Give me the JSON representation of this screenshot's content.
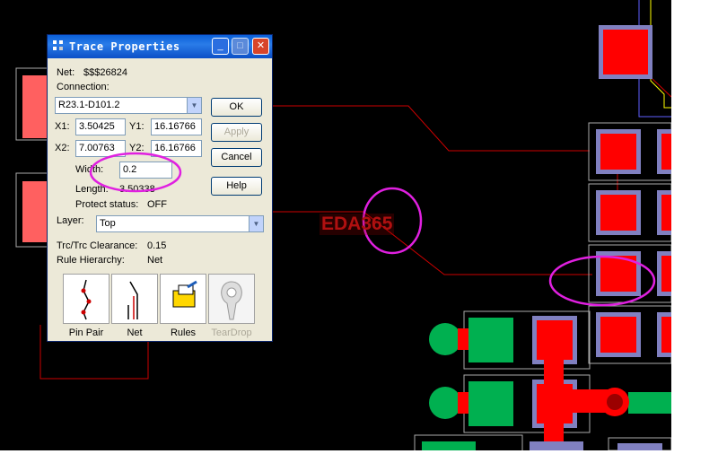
{
  "dialog": {
    "title": "Trace Properties",
    "net_label": "Net:",
    "net_value": "$$$26824",
    "connection_label": "Connection:",
    "connection_value": "R23.1-D101.2",
    "x1_label": "X1:",
    "x1_value": "3.50425",
    "y1_label": "Y1:",
    "y1_value": "16.16766",
    "x2_label": "X2:",
    "x2_value": "7.00763",
    "y2_label": "Y2:",
    "y2_value": "16.16766",
    "width_label": "Width:",
    "width_value": "0.2",
    "length_label": "Length:",
    "length_value": "3.50338",
    "protect_label": "Protect status:",
    "protect_value": "OFF",
    "layer_label": "Layer:",
    "layer_value": "Top",
    "clearance_label": "Trc/Trc Clearance:",
    "clearance_value": "0.15",
    "hierarchy_label": "Rule Hierarchy:",
    "hierarchy_value": "Net",
    "buttons": {
      "ok": "OK",
      "apply": "Apply",
      "cancel": "Cancel",
      "help": "Help"
    },
    "tools": {
      "pin_pair": "Pin Pair",
      "net": "Net",
      "rules": "Rules",
      "teardrop": "TearDrop"
    }
  },
  "watermark": "EDA365",
  "colors": {
    "pad": "#ff0000",
    "pad_outline": "#8080c0",
    "copper_green": "#00b050",
    "trace": "#cc0000",
    "annotation": "#e020e0",
    "title_blue": "#0a5fd8"
  }
}
